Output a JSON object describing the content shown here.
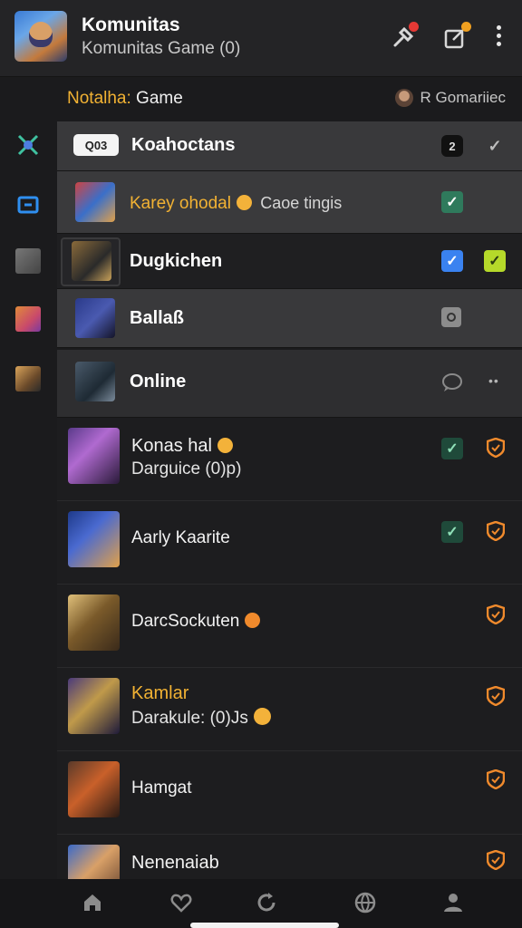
{
  "header": {
    "title": "Komunitas",
    "subtitle": "Komunitas Game (0)",
    "avatar_icon": "game-character-avatar",
    "actions": [
      {
        "name": "pin-icon",
        "badge_color": "#e53935"
      },
      {
        "name": "edit-icon",
        "badge_color": "#f0a020"
      },
      {
        "name": "more-vertical-icon"
      }
    ]
  },
  "section": {
    "title_accent": "Notalha:",
    "title_rest": " Game",
    "user_label": "R Gomariiec"
  },
  "rail": [
    "sword-emblem-icon",
    "chat-bubble-icon",
    "character-portrait-icon",
    "character-portrait-icon",
    "character-portrait-icon"
  ],
  "channels": [
    {
      "name": "Koahoctans",
      "search_chip": "Q03",
      "badge": "2",
      "check": "✓"
    },
    {
      "name": "Karey ohodal",
      "status_text": "Caoe tingis",
      "check": "✓",
      "highlight": true
    },
    {
      "name": "Dugkichen",
      "check": "✓",
      "check2": "✓"
    },
    {
      "name": "Ballaß"
    }
  ],
  "online": {
    "title": "Online",
    "more": "••"
  },
  "members": [
    {
      "name": "Konas hal",
      "sub": "Darguice (0)p)",
      "check": "✓"
    },
    {
      "name": "Aarly Kaarite",
      "check": "✓"
    },
    {
      "name": "DarcSockuten",
      "emoji": true
    },
    {
      "name": "Kamlar",
      "sub": "Darakule: (0)Js",
      "name_color": "#f2b233"
    },
    {
      "name": "Hamgat"
    },
    {
      "name": "Nenenaiab"
    }
  ],
  "colors": {
    "accent": "#f2b233",
    "shield": "#f08a2c",
    "check_green": "#2f7a5c",
    "check_blue": "#3a82f0",
    "check_lime": "#b5d92a"
  },
  "tabs": [
    "home-icon",
    "heart-icon",
    "refresh-icon",
    "globe-icon",
    "profile-icon"
  ]
}
